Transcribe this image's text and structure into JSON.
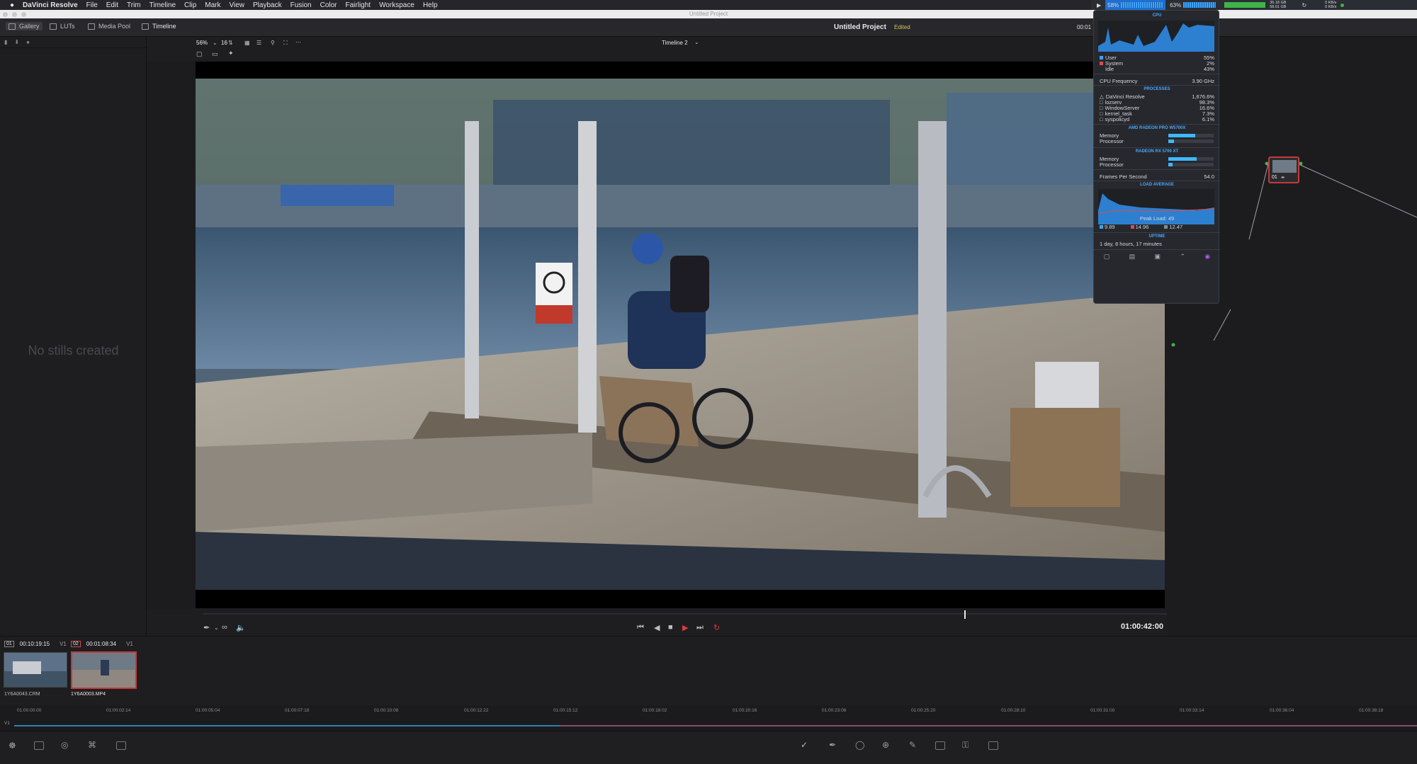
{
  "menubar": {
    "app_name": "DaVinci Resolve",
    "items": [
      "File",
      "Edit",
      "Trim",
      "Timeline",
      "Clip",
      "Mark",
      "View",
      "Playback",
      "Fusion",
      "Color",
      "Fairlight",
      "Workspace",
      "Help"
    ],
    "window_title": "Untitled Project",
    "stats": {
      "cpu_percent": "58%",
      "gpu_percent": "63%",
      "disk_top": "36.18 GB",
      "disk_bottom": "58.61 GB",
      "net_top": "0 KB/s",
      "net_bottom": "0 KB/s"
    }
  },
  "toolbar": {
    "tabs": [
      {
        "label": "Gallery",
        "icon": "gallery-icon"
      },
      {
        "label": "LUTs",
        "icon": "luts-icon"
      },
      {
        "label": "Media Pool",
        "icon": "media-pool-icon"
      },
      {
        "label": "Timeline",
        "icon": "timeline-icon"
      }
    ],
    "project_title": "Untitled Project",
    "project_status": "Edited",
    "timecode_partial": "00:01"
  },
  "gallery": {
    "empty_message": "No stills created"
  },
  "viewer": {
    "zoom": "56%",
    "frame_count": "16",
    "timeline_name": "Timeline 2",
    "timecode": "01:00:42:00",
    "playhead_fraction": 0.79
  },
  "istat": {
    "cpu_title": "CPU",
    "user_label": "User",
    "user_value": "55%",
    "system_label": "System",
    "system_value": "2%",
    "idle_label": "Idle",
    "idle_value": "43%",
    "freq_label": "CPU Frequency",
    "freq_value": "3.90 GHz",
    "processes_title": "PROCESSES",
    "processes": [
      {
        "name": "DaVinci Resolve",
        "value": "1,676.6%"
      },
      {
        "name": "lozserv",
        "value": "98.3%"
      },
      {
        "name": "WindowServer",
        "value": "16.6%"
      },
      {
        "name": "kernel_task",
        "value": "7.3%"
      },
      {
        "name": "syspolicyd",
        "value": "6.1%"
      }
    ],
    "gpu1_title": "AMD RADEON PRO W5700X",
    "gpu1_memory_label": "Memory",
    "gpu1_memory_fill": 0.6,
    "gpu1_processor_label": "Processor",
    "gpu1_processor_fill": 0.12,
    "gpu2_title": "RADEON RX 5700 XT",
    "gpu2_memory_label": "Memory",
    "gpu2_memory_fill": 0.62,
    "gpu2_processor_label": "Processor",
    "gpu2_processor_fill": 0.1,
    "fps_label": "Frames Per Second",
    "fps_value": "54.0",
    "load_title": "LOAD AVERAGE",
    "peak_load": "Peak Load: 49",
    "load_1": "9.89",
    "load_5": "14.96",
    "load_15": "12.47",
    "uptime_title": "UPTIME",
    "uptime_value": "1 day, 8 hours, 17 minutes"
  },
  "clips": [
    {
      "number": "01",
      "timecode": "00:10:19:15",
      "track": "V1",
      "name": "1Y6A0043.CRM",
      "selected": false
    },
    {
      "number": "02",
      "timecode": "00:01:08:34",
      "track": "V1",
      "name": "1Y6A0003.MP4",
      "selected": true
    }
  ],
  "mini_timeline": {
    "track_label": "V1",
    "ticks": [
      "01:00:00:00",
      "01:00:02:14",
      "01:00:05:04",
      "01:00:07:18",
      "01:00:10:08",
      "01:00:12:22",
      "01:00:15:12",
      "01:00:18:02",
      "01:00:20:16",
      "01:00:23:06",
      "01:00:25:20",
      "01:00:28:10",
      "01:00:31:00",
      "01:00:33:14",
      "01:00:36:04",
      "01:00:38:18"
    ]
  },
  "node": {
    "label": "01"
  },
  "colors": {
    "accent_red": "#c23a3a",
    "accent_blue": "#3ea3ff",
    "status_yellow": "#d6c15a"
  }
}
